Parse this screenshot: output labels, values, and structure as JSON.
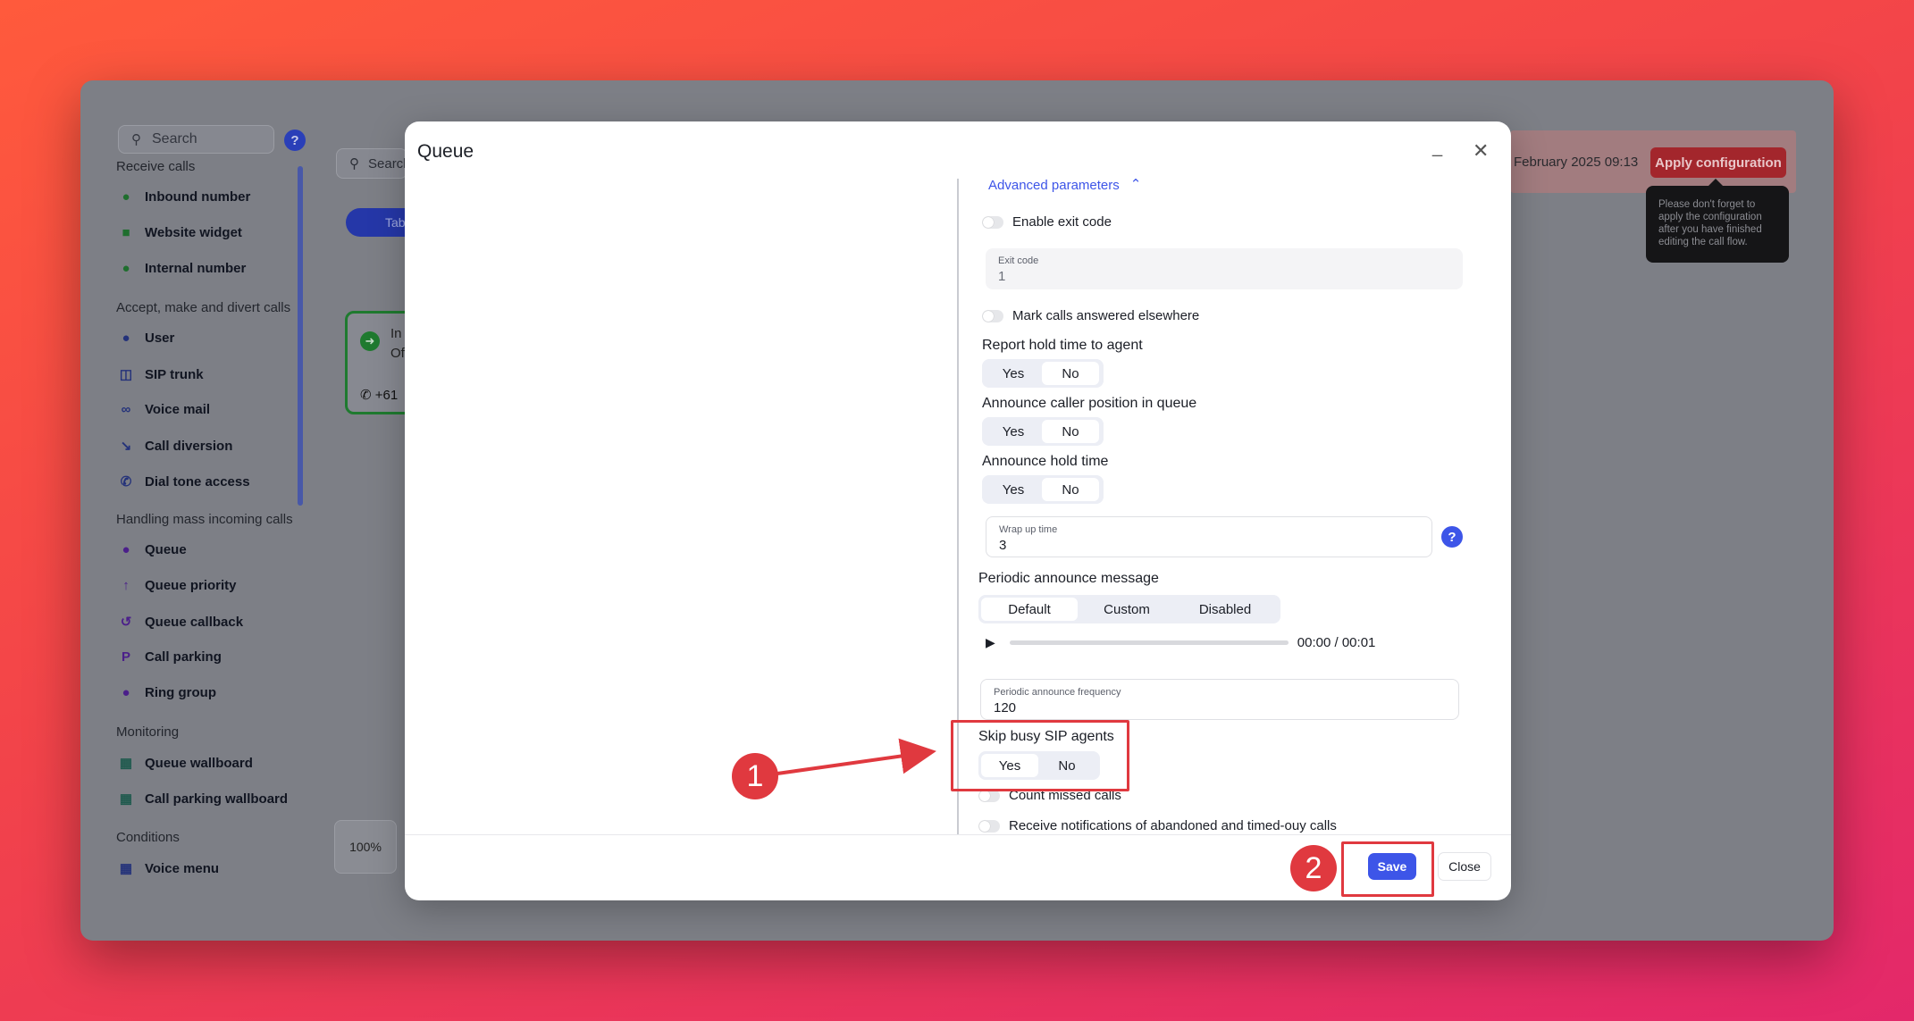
{
  "sidebar": {
    "search_placeholder": "Search",
    "help": "?",
    "sections": [
      {
        "title": "Receive calls"
      },
      {
        "title": "Accept, make and divert calls"
      },
      {
        "title": "Handling mass incoming calls"
      },
      {
        "title": "Monitoring"
      },
      {
        "title": "Conditions"
      }
    ],
    "items": [
      {
        "label": "Inbound number",
        "icon": "plus-circle-icon"
      },
      {
        "label": "Website widget",
        "icon": "widget-icon"
      },
      {
        "label": "Internal number",
        "icon": "plus-circle-icon"
      },
      {
        "label": "User",
        "icon": "user-icon"
      },
      {
        "label": "SIP trunk",
        "icon": "sip-trunk-icon"
      },
      {
        "label": "Voice mail",
        "icon": "voicemail-icon"
      },
      {
        "label": "Call diversion",
        "icon": "call-diversion-icon"
      },
      {
        "label": "Dial tone access",
        "icon": "phone-icon"
      },
      {
        "label": "Queue",
        "icon": "queue-icon"
      },
      {
        "label": "Queue priority",
        "icon": "arrow-up-icon"
      },
      {
        "label": "Queue callback",
        "icon": "reply-all-icon"
      },
      {
        "label": "Call parking",
        "icon": "parking-icon"
      },
      {
        "label": "Ring group",
        "icon": "group-icon"
      },
      {
        "label": "Queue wallboard",
        "icon": "wallboard-icon"
      },
      {
        "label": "Call parking wallboard",
        "icon": "wallboard-icon"
      },
      {
        "label": "Voice menu",
        "icon": "grid-icon"
      }
    ]
  },
  "background": {
    "search_label": "Search",
    "tab_label": "Tab",
    "node_title": "In",
    "node_subtitle": "Of",
    "node_phone": "+61",
    "zoom": "100%",
    "date": "February 2025 09:13",
    "apply_button": "Apply configuration",
    "tooltip": "Please don't forget to apply the configuration after you have finished editing the call flow."
  },
  "modal": {
    "title": "Queue",
    "minimize": "_",
    "close": "✕",
    "advanced_link": "Advanced parameters",
    "enable_exit_code": "Enable exit code",
    "exit_code": {
      "label": "Exit code",
      "value": "1"
    },
    "mark_answered": "Mark calls answered elsewhere",
    "report_hold": {
      "label": "Report hold time to agent",
      "yes": "Yes",
      "no": "No",
      "selected": "No"
    },
    "announce_position": {
      "label": "Announce caller position in queue",
      "yes": "Yes",
      "no": "No",
      "selected": "No"
    },
    "announce_hold": {
      "label": "Announce hold time",
      "yes": "Yes",
      "no": "No",
      "selected": "No"
    },
    "wrap_up": {
      "label": "Wrap up time",
      "value": "3"
    },
    "help": "?",
    "periodic_msg": {
      "label": "Periodic announce message",
      "options": [
        "Default",
        "Custom",
        "Disabled"
      ],
      "selected": "Default"
    },
    "audio": {
      "current": "00:00",
      "sep": "/",
      "total": "00:01",
      "progress": 0
    },
    "periodic_freq": {
      "label": "Periodic announce frequency",
      "value": "120"
    },
    "skip_busy": {
      "label": "Skip busy SIP agents",
      "yes": "Yes",
      "no": "No",
      "selected": "Yes"
    },
    "count_missed": "Count missed calls",
    "receive_notifications": "Receive notifications of abandoned and timed-ouy calls",
    "save": "Save",
    "close_button": "Close"
  },
  "annotations": {
    "marker1": "1",
    "marker2": "2",
    "color": "#e0393f"
  }
}
